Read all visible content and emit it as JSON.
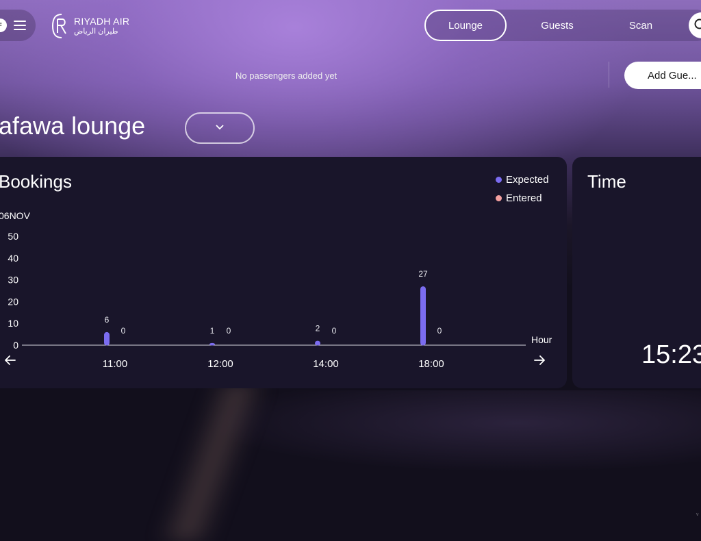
{
  "header": {
    "avatar_initial": "F",
    "logo": {
      "name_en": "RIYADH AIR",
      "name_ar": "طيران الرياض"
    },
    "nav_tabs": [
      {
        "label": "Lounge",
        "active": true
      },
      {
        "label": "Guests",
        "active": false
      },
      {
        "label": "Scan",
        "active": false
      }
    ]
  },
  "passengers": {
    "empty_text": "No passengers added yet",
    "add_button_label": "Add Gue..."
  },
  "lounge": {
    "title": "lafawa lounge",
    "dropdown_icon": "chevron-down-icon"
  },
  "bookings": {
    "title": "Bookings",
    "date_label": "06NOV",
    "legend": [
      {
        "label": "Expected",
        "color": "#7b6cf0"
      },
      {
        "label": "Entered",
        "color": "#f4a0a0"
      }
    ],
    "x_axis_label": "Hour",
    "prev_icon": "arrow-left-icon",
    "next_icon": "arrow-right-icon"
  },
  "time": {
    "title": "Time",
    "value": "15:23"
  },
  "chart_data": {
    "type": "bar",
    "categories": [
      "11:00",
      "12:00",
      "14:00",
      "18:00"
    ],
    "series": [
      {
        "name": "Expected",
        "values": [
          6,
          1,
          2,
          27
        ],
        "color": "#7b6cf0"
      },
      {
        "name": "Entered",
        "values": [
          0,
          0,
          0,
          0
        ],
        "color": "#f4a0a0"
      }
    ],
    "date": "06NOV",
    "xlabel": "Hour",
    "ylabel": "",
    "yticks": [
      0,
      10,
      20,
      30,
      40,
      50
    ],
    "ylim": [
      0,
      50
    ],
    "legend_position": "top-right",
    "grid": false
  },
  "footer": {
    "corner_text": "v"
  }
}
